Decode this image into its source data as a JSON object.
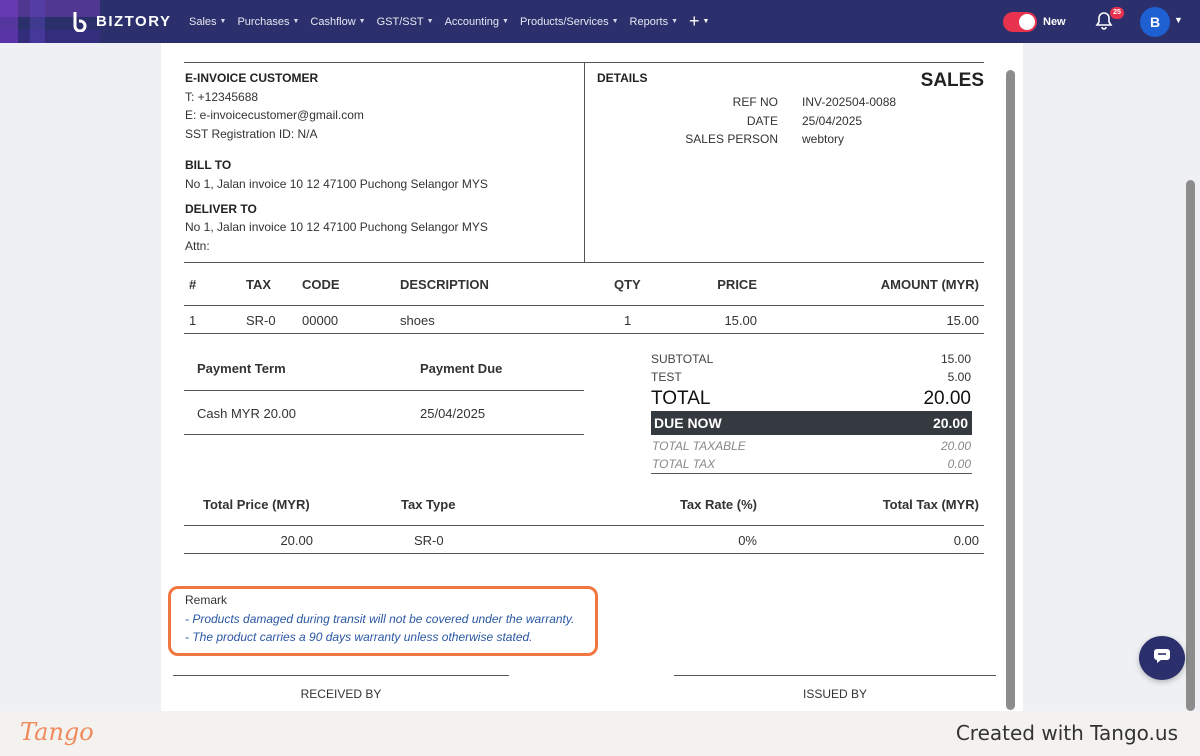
{
  "app": {
    "brand": "BIZTORY"
  },
  "nav": {
    "items": [
      "Sales",
      "Purchases",
      "Cashflow",
      "GST/SST",
      "Accounting",
      "Products/Services",
      "Reports"
    ],
    "plus_label": "+",
    "toggle_label": "New",
    "notification_count": "25",
    "avatar_initial": "B"
  },
  "invoice": {
    "customer": {
      "heading": "E-INVOICE CUSTOMER",
      "phone": "T: +12345688",
      "email": "E: e-invoicecustomer@gmail.com",
      "sst": "SST Registration ID: N/A",
      "bill_to_heading": "BILL TO",
      "bill_to": "No 1, Jalan invoice 10 12 47100 Puchong Selangor MYS",
      "deliver_to_heading": "DELIVER TO",
      "deliver_to": "No 1, Jalan invoice 10 12 47100 Puchong Selangor MYS",
      "attn": "Attn:"
    },
    "details": {
      "heading": "DETAILS",
      "doc_type": "SALES",
      "ref_label": "REF NO",
      "ref_value": "INV-202504-0088",
      "date_label": "DATE",
      "date_value": "25/04/2025",
      "salesperson_label": "SALES PERSON",
      "salesperson_value": "webtory"
    },
    "items_table": {
      "headers": [
        "#",
        "TAX",
        "CODE",
        "DESCRIPTION",
        "QTY",
        "PRICE",
        "AMOUNT (MYR)"
      ],
      "rows": [
        [
          "1",
          "SR-0",
          "00000",
          "shoes",
          "1",
          "15.00",
          "15.00"
        ]
      ]
    },
    "payment": {
      "term_header": "Payment Term",
      "due_header": "Payment Due",
      "term_value": "Cash MYR 20.00",
      "due_value": "25/04/2025"
    },
    "totals": {
      "subtotal_label": "SUBTOTAL",
      "subtotal_value": "15.00",
      "test_label": "TEST",
      "test_value": "5.00",
      "total_label": "TOTAL",
      "total_value": "20.00",
      "due_now_label": "DUE NOW",
      "due_now_value": "20.00",
      "taxable_label": "TOTAL TAXABLE",
      "taxable_value": "20.00",
      "tax_label": "TOTAL TAX",
      "tax_value": "0.00"
    },
    "tax_table": {
      "headers": [
        "Total Price (MYR)",
        "Tax Type",
        "Tax Rate (%)",
        "Total Tax (MYR)"
      ],
      "row": [
        "20.00",
        "SR-0",
        "0%",
        "0.00"
      ]
    },
    "remark": {
      "label": "Remark",
      "lines": [
        "- Products damaged during transit will not be covered under the warranty.",
        "- The product carries a 90 days warranty unless otherwise stated."
      ]
    },
    "signatures": {
      "received_by": "RECEIVED BY",
      "issued_by": "ISSUED BY"
    }
  },
  "footer": {
    "logo": "Tango",
    "credit": "Created with Tango.us"
  },
  "colors": {
    "nav_bg": "#2b2f6b",
    "toggle": "#e8334f",
    "highlight_border": "#f07840",
    "remark_text": "#2a57a4"
  }
}
